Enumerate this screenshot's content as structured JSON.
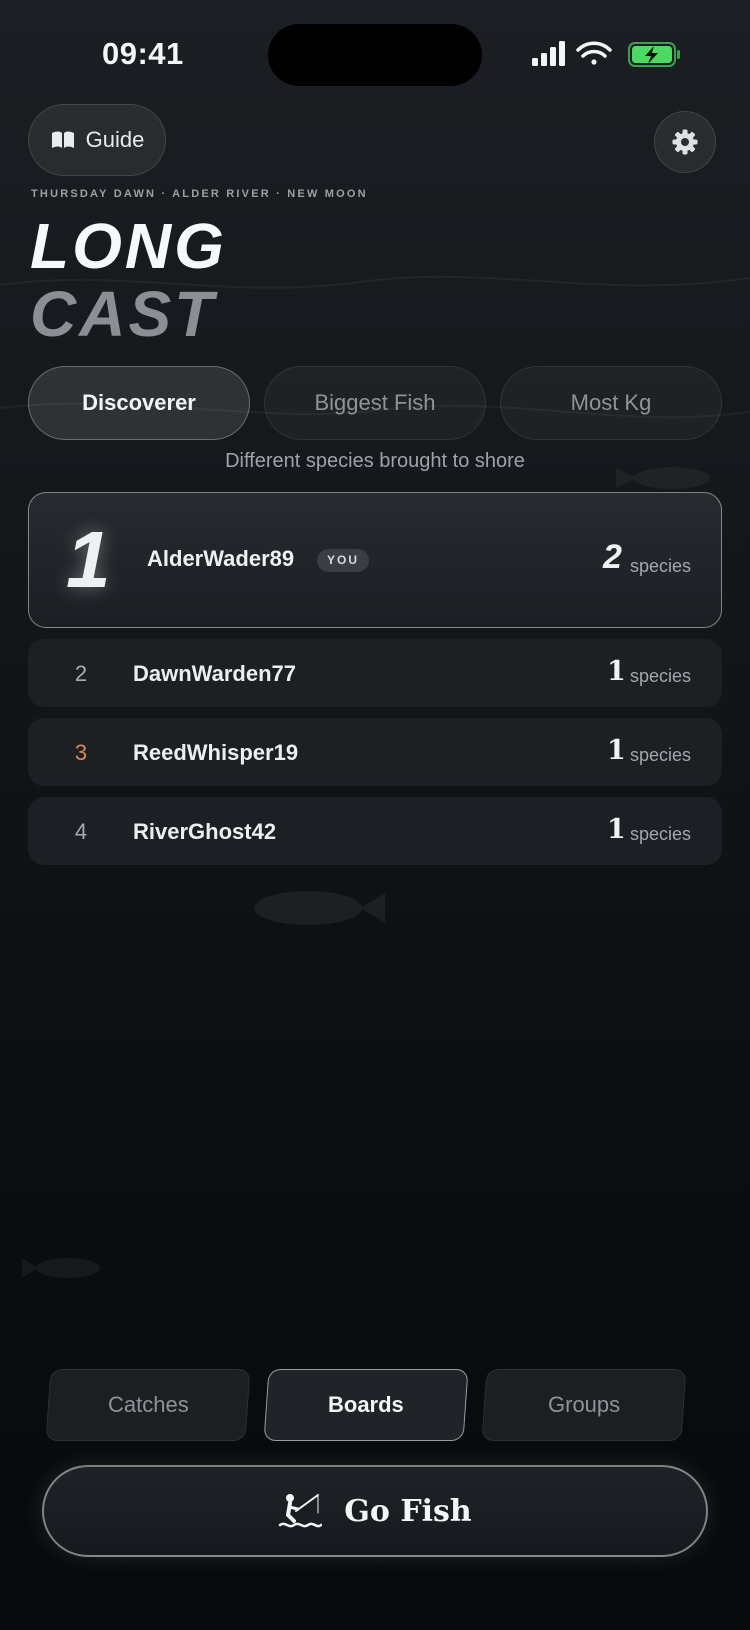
{
  "status_bar": {
    "time": "09:41",
    "icons": [
      "signal-icon",
      "wifi-icon",
      "battery-charging-icon"
    ],
    "battery_color": "#4cd964"
  },
  "header": {
    "guide_label": "Guide",
    "guide_icon": "book-icon",
    "settings_icon": "gear-icon",
    "subtitle": "THURSDAY DAWN · ALDER RIVER · NEW MOON",
    "title_line1": "LONG",
    "title_line2": "CAST"
  },
  "segments": {
    "items": [
      {
        "label": "Discoverer",
        "active": true
      },
      {
        "label": "Biggest Fish",
        "active": false
      },
      {
        "label": "Most Kg",
        "active": false
      }
    ],
    "caption": "Different species brought to shore"
  },
  "leaderboard": {
    "first": {
      "rank": "1",
      "name": "AlderWader89",
      "badge": "YOU",
      "value": "2",
      "unit": "species"
    },
    "rows": [
      {
        "rank": "2",
        "name": "DawnWarden77",
        "value": "1",
        "unit": "species"
      },
      {
        "rank": "3",
        "name": "ReedWhisper19",
        "value": "1",
        "unit": "species",
        "rank_color": "#d98a5a"
      },
      {
        "rank": "4",
        "name": "RiverGhost42",
        "value": "1",
        "unit": "species"
      }
    ]
  },
  "tabs": [
    {
      "label": "Catches",
      "active": false
    },
    {
      "label": "Boards",
      "active": true
    },
    {
      "label": "Groups",
      "active": false
    }
  ],
  "primary_action": {
    "label": "Go Fish",
    "icon": "angler-icon"
  }
}
